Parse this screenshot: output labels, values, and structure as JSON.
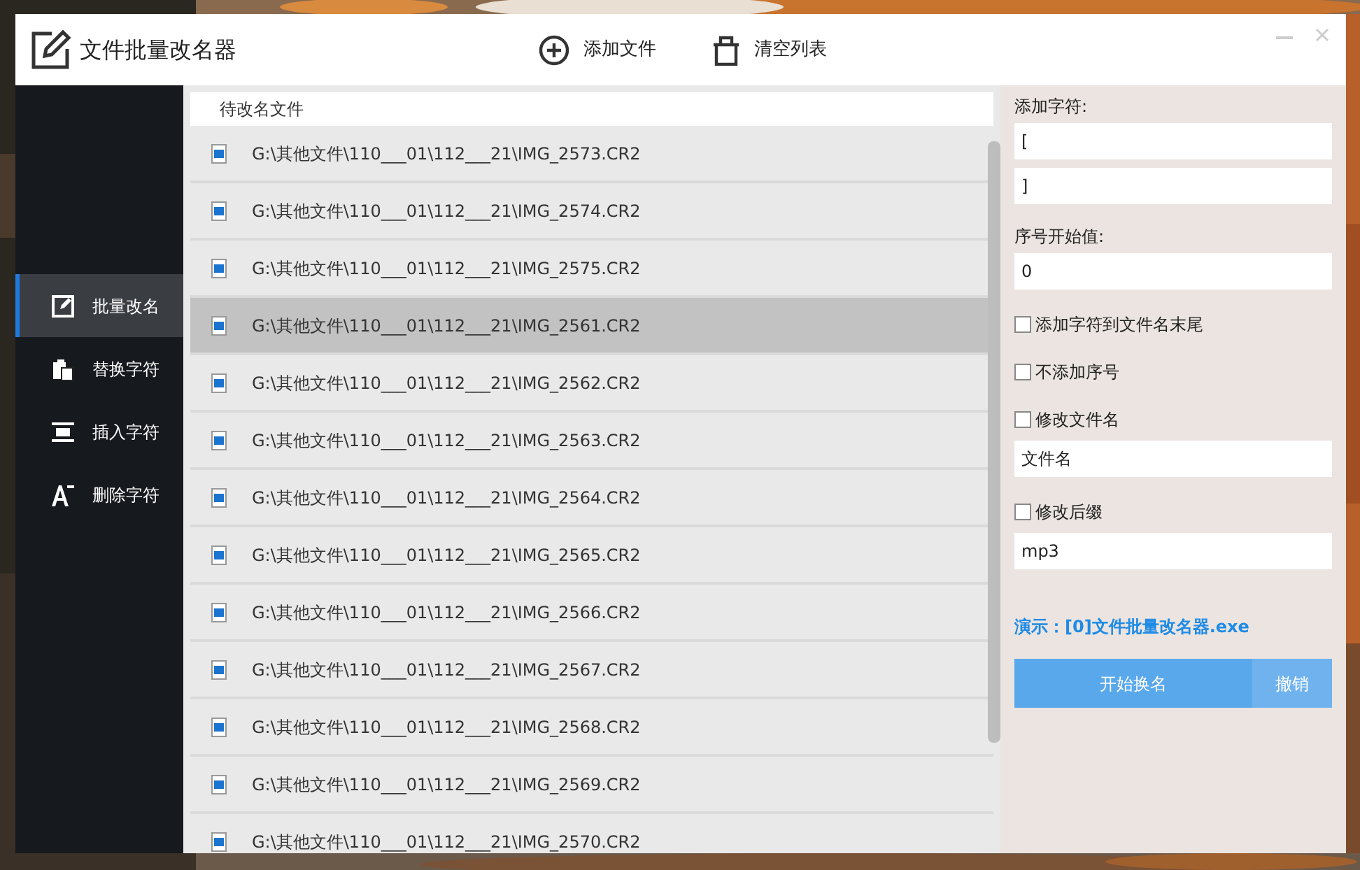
{
  "window": {
    "title": "文件批量改名器"
  },
  "toolbar": [
    {
      "kind": "add",
      "label": "添加文件"
    },
    {
      "kind": "clear",
      "label": "清空列表"
    }
  ],
  "sidebar": {
    "items": [
      {
        "kind": "edit",
        "label": "批量改名",
        "selected": true
      },
      {
        "kind": "replace",
        "label": "替换字符",
        "selected": false
      },
      {
        "kind": "insert",
        "label": "插入字符",
        "selected": false
      },
      {
        "kind": "delete",
        "label": "删除字符",
        "selected": false
      }
    ]
  },
  "file_list": {
    "header": "待改名文件",
    "rows": [
      {
        "path": "G:\\其他文件\\110___01\\112___21\\IMG_2573.CR2",
        "selected": false
      },
      {
        "path": "G:\\其他文件\\110___01\\112___21\\IMG_2574.CR2",
        "selected": false
      },
      {
        "path": "G:\\其他文件\\110___01\\112___21\\IMG_2575.CR2",
        "selected": false
      },
      {
        "path": "G:\\其他文件\\110___01\\112___21\\IMG_2561.CR2",
        "selected": true
      },
      {
        "path": "G:\\其他文件\\110___01\\112___21\\IMG_2562.CR2",
        "selected": false
      },
      {
        "path": "G:\\其他文件\\110___01\\112___21\\IMG_2563.CR2",
        "selected": false
      },
      {
        "path": "G:\\其他文件\\110___01\\112___21\\IMG_2564.CR2",
        "selected": false
      },
      {
        "path": "G:\\其他文件\\110___01\\112___21\\IMG_2565.CR2",
        "selected": false
      },
      {
        "path": "G:\\其他文件\\110___01\\112___21\\IMG_2566.CR2",
        "selected": false
      },
      {
        "path": "G:\\其他文件\\110___01\\112___21\\IMG_2567.CR2",
        "selected": false
      },
      {
        "path": "G:\\其他文件\\110___01\\112___21\\IMG_2568.CR2",
        "selected": false
      },
      {
        "path": "G:\\其他文件\\110___01\\112___21\\IMG_2569.CR2",
        "selected": false
      },
      {
        "path": "G:\\其他文件\\110___01\\112___21\\IMG_2570.CR2",
        "selected": false
      }
    ]
  },
  "options": [
    {
      "kind": "label",
      "text": "添加字符:"
    },
    {
      "kind": "field",
      "value": "["
    },
    {
      "kind": "field",
      "value": "]"
    },
    {
      "kind": "label",
      "text": "序号开始值:"
    },
    {
      "kind": "field",
      "value": "0"
    },
    {
      "kind": "checkbox",
      "text": "添加字符到文件名末尾",
      "checked": false
    },
    {
      "kind": "checkbox",
      "text": "不添加序号",
      "checked": false
    },
    {
      "kind": "checkbox",
      "text": "修改文件名",
      "checked": false
    },
    {
      "kind": "field",
      "value": "文件名"
    },
    {
      "kind": "checkbox",
      "text": "修改后缀",
      "checked": false
    },
    {
      "kind": "field",
      "value": "mp3"
    }
  ],
  "preview": "演示：[0]文件批量改名器.exe",
  "actions": {
    "start": "开始换名",
    "cancel": "撤销"
  }
}
